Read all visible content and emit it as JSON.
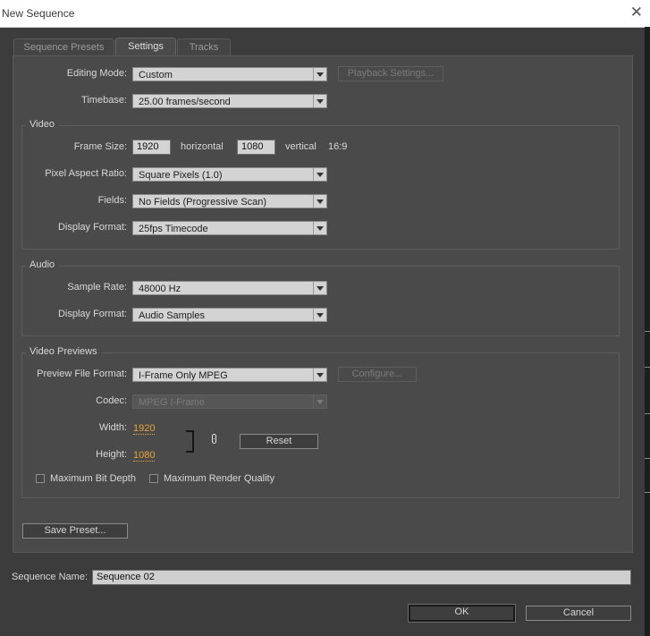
{
  "window": {
    "title": "New Sequence",
    "close_icon": "close-icon"
  },
  "tabs": [
    {
      "label": "Sequence Presets"
    },
    {
      "label": "Settings"
    },
    {
      "label": "Tracks"
    }
  ],
  "settings": {
    "editing_mode": {
      "label": "Editing Mode:",
      "value": "Custom"
    },
    "playback_settings_button": "Playback Settings...",
    "timebase": {
      "label": "Timebase:",
      "value": "25.00 frames/second"
    }
  },
  "video": {
    "group_label": "Video",
    "frame_size_label": "Frame Size:",
    "frame_width": "1920",
    "horizontal_label": "horizontal",
    "frame_height": "1080",
    "vertical_label": "vertical",
    "aspect": "16:9",
    "pixel_aspect_ratio": {
      "label": "Pixel Aspect Ratio:",
      "value": "Square Pixels (1.0)"
    },
    "fields": {
      "label": "Fields:",
      "value": "No Fields (Progressive Scan)"
    },
    "display_format": {
      "label": "Display Format:",
      "value": "25fps Timecode"
    }
  },
  "audio": {
    "group_label": "Audio",
    "sample_rate": {
      "label": "Sample Rate:",
      "value": "48000 Hz"
    },
    "display_format": {
      "label": "Display Format:",
      "value": "Audio Samples"
    }
  },
  "video_previews": {
    "group_label": "Video Previews",
    "preview_file_format": {
      "label": "Preview File Format:",
      "value": "I-Frame Only MPEG"
    },
    "configure_button": "Configure...",
    "codec": {
      "label": "Codec:",
      "value": "MPEG I-Frame"
    },
    "width": {
      "label": "Width:",
      "value": "1920"
    },
    "height": {
      "label": "Height:",
      "value": "1080"
    },
    "reset_button": "Reset",
    "max_bit_depth": {
      "label": "Maximum Bit Depth",
      "checked": false
    },
    "max_render_quality": {
      "label": "Maximum Render Quality",
      "checked": false
    }
  },
  "save_preset_button": "Save Preset...",
  "sequence_name": {
    "label": "Sequence Name:",
    "value": "Sequence 02"
  },
  "ok_button": "OK",
  "cancel_button": "Cancel"
}
